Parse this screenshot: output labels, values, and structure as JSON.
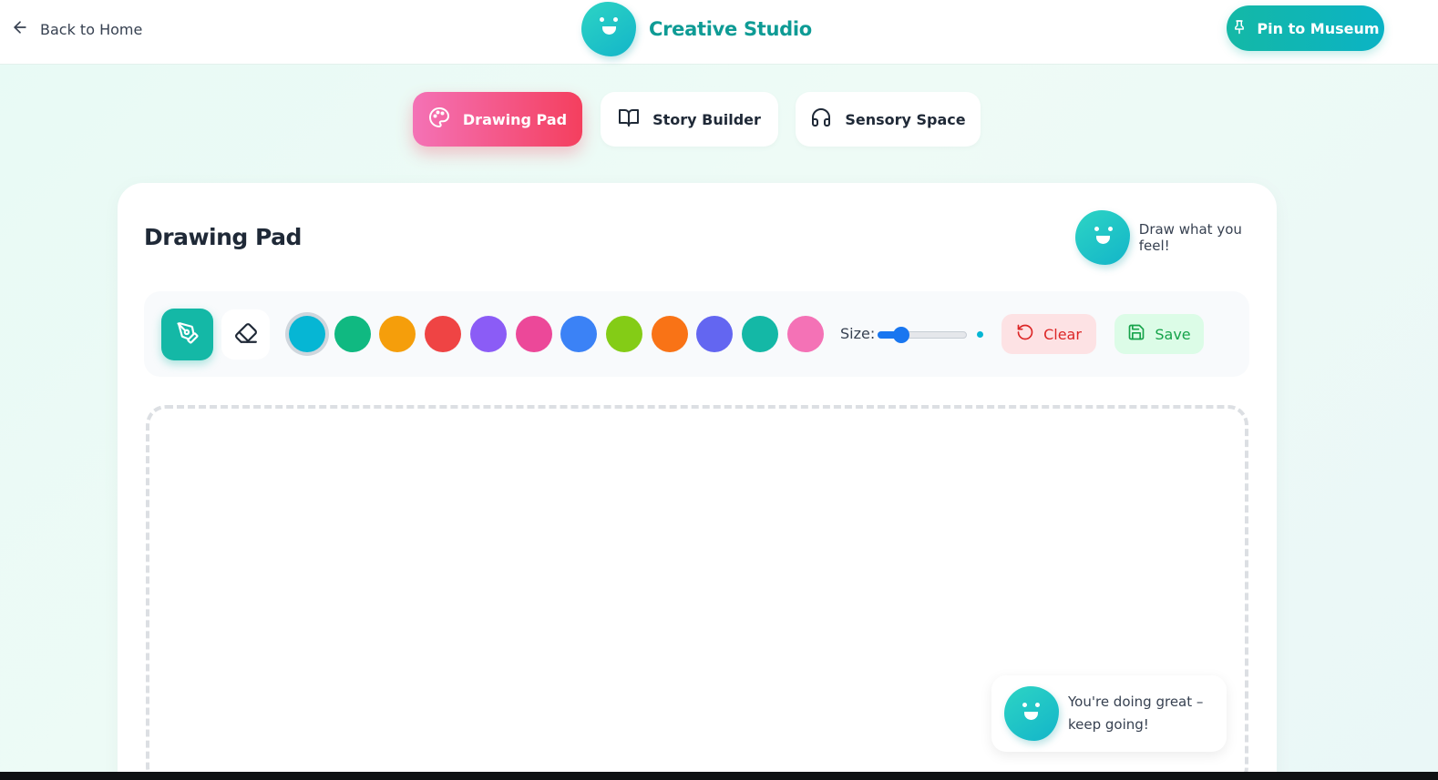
{
  "header": {
    "back_label": "Back to Home",
    "brand_title": "Creative Studio",
    "pin_label": "Pin to Museum"
  },
  "tabs": [
    {
      "label": "Drawing Pad",
      "icon": "palette-icon",
      "active": true
    },
    {
      "label": "Story Builder",
      "icon": "book-open-icon",
      "active": false
    },
    {
      "label": "Sensory Space",
      "icon": "headphones-icon",
      "active": false
    }
  ],
  "card": {
    "title": "Drawing Pad",
    "hint": "Draw what you feel!"
  },
  "toolbar": {
    "tools": [
      {
        "name": "pen",
        "icon": "pen-tool-icon",
        "active": true
      },
      {
        "name": "eraser",
        "icon": "eraser-icon",
        "active": false
      }
    ],
    "colors": [
      "#06b6d4",
      "#10b981",
      "#f59e0b",
      "#ef4444",
      "#8b5cf6",
      "#ec4899",
      "#3b82f6",
      "#84cc16",
      "#f97316",
      "#6366f1",
      "#14b8a6",
      "#f472b6"
    ],
    "selected_color": "#06b6d4",
    "size_label": "Size:",
    "size_value": 0.27,
    "clear_label": "Clear",
    "save_label": "Save"
  },
  "encouragement": "You're doing great – keep going!",
  "colors": {
    "accent": "#14b8a6",
    "brand_text": "#0e9b95",
    "active_tab": "#f43f5e"
  }
}
